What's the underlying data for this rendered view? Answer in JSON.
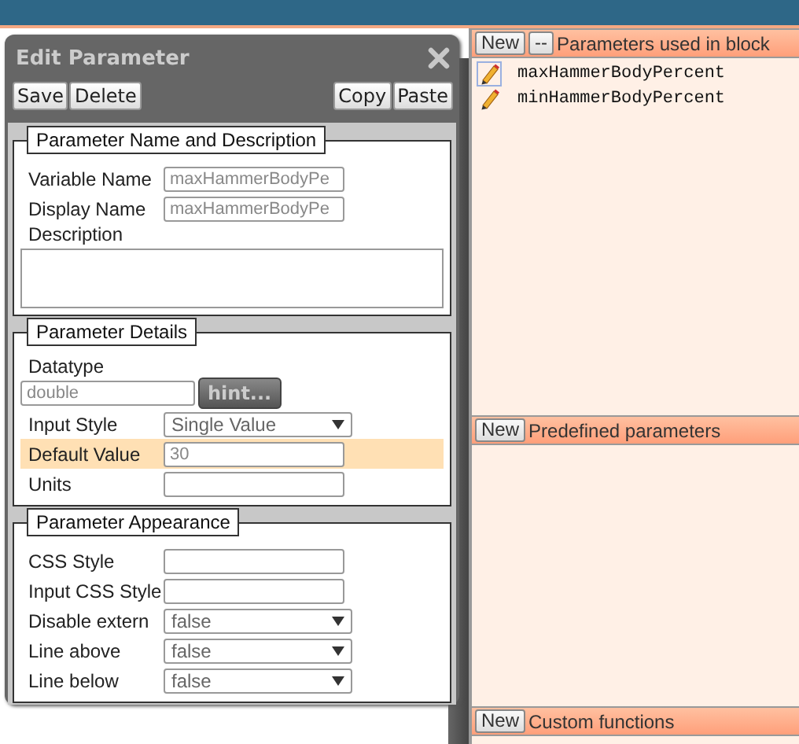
{
  "dialog": {
    "title": "Edit Parameter",
    "buttons_left": [
      "Save",
      "Delete"
    ],
    "buttons_right": [
      "Copy",
      "Paste"
    ],
    "sections": [
      {
        "legend": "Parameter Name and Description",
        "fields": [
          {
            "kind": "text",
            "label": "Variable Name",
            "value": "maxHammerBodyPe",
            "highlighted": false
          },
          {
            "kind": "text",
            "label": "Display Name",
            "value": "maxHammerBodyPe",
            "highlighted": false
          },
          {
            "kind": "textarea",
            "label": "Description",
            "highlighted": false
          }
        ]
      },
      {
        "legend": "Parameter Details",
        "fields": [
          {
            "kind": "datatype",
            "label": "Datatype",
            "value": "double",
            "button": "hint...",
            "highlighted": false
          },
          {
            "kind": "select",
            "label": "Input Style",
            "value": "Single Value",
            "highlighted": false
          },
          {
            "kind": "text",
            "label": "Default Value",
            "value": "30",
            "highlighted": true
          },
          {
            "kind": "text",
            "label": "Units",
            "highlighted": false
          }
        ]
      },
      {
        "legend": "Parameter Appearance",
        "fields": [
          {
            "kind": "text",
            "label": "CSS Style",
            "highlighted": false
          },
          {
            "kind": "text",
            "label": "Input CSS Style",
            "highlighted": false
          },
          {
            "kind": "select",
            "label": "Disable extern",
            "value": "false",
            "highlighted": false
          },
          {
            "kind": "select",
            "label": "Line above",
            "value": "false",
            "highlighted": false
          },
          {
            "kind": "select",
            "label": "Line below",
            "value": "false",
            "highlighted": false
          }
        ]
      }
    ]
  },
  "panels": [
    {
      "title": "Parameters used in block",
      "buttons": [
        "New",
        "--"
      ],
      "items": [
        {
          "name": "maxHammerBodyPercent",
          "selected": true
        },
        {
          "name": "minHammerBodyPercent",
          "selected": false
        }
      ]
    },
    {
      "title": "Predefined parameters",
      "buttons": [
        "New"
      ]
    },
    {
      "title": "Custom functions",
      "buttons": [
        "New"
      ]
    }
  ]
}
